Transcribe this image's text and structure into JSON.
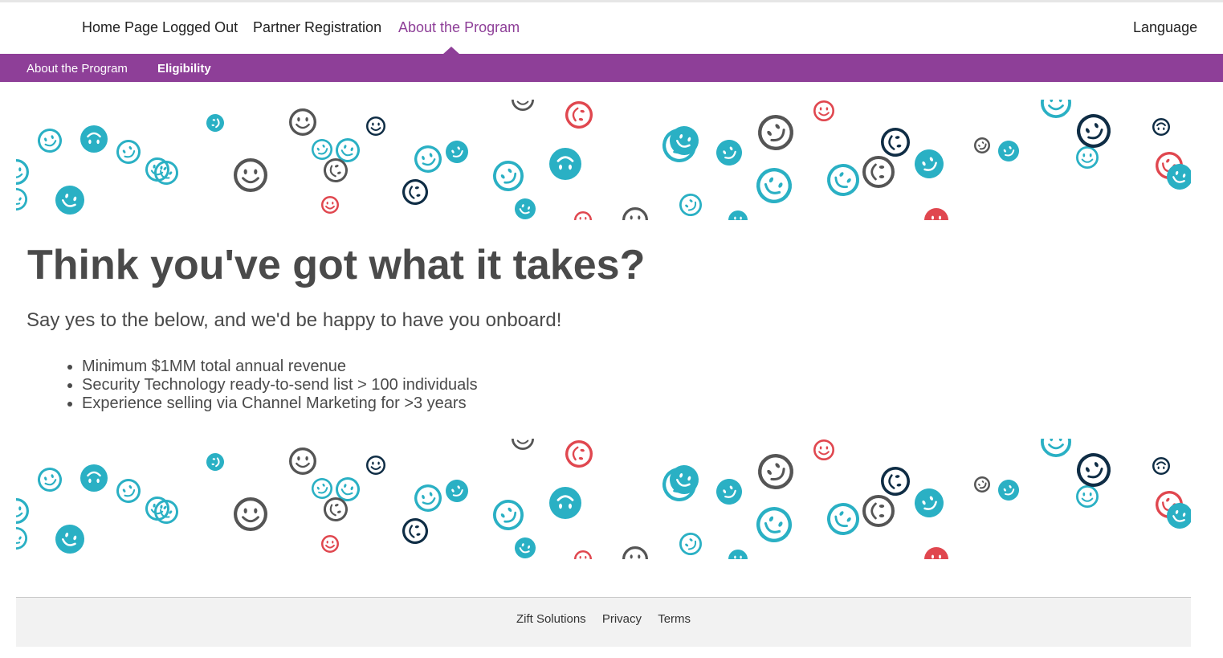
{
  "topnav": {
    "home": "Home Page Logged Out",
    "registration": "Partner Registration",
    "about": "About the Program",
    "language": "Language"
  },
  "subnav": {
    "about": "About the Program",
    "eligibility": "Eligibility"
  },
  "main": {
    "headline": "Think you've got what it takes?",
    "subhead": "Say yes to the below, and we'd be happy to have you onboard!",
    "requirements": [
      "Minimum $1MM total annual revenue",
      "Security Technology ready-to-send list > 100 individuals",
      "Experience selling via Channel Marketing for >3 years"
    ]
  },
  "footer": {
    "links": [
      "Zift Solutions",
      "Privacy",
      "Terms"
    ]
  },
  "colors": {
    "brand_purple": "#8e3f98",
    "smiley_teal": "#2ab0c4",
    "smiley_gray": "#555555",
    "smiley_navy": "#0f2d45",
    "smiley_red": "#e0474f"
  },
  "icons": [
    "smiley-face-icon"
  ]
}
